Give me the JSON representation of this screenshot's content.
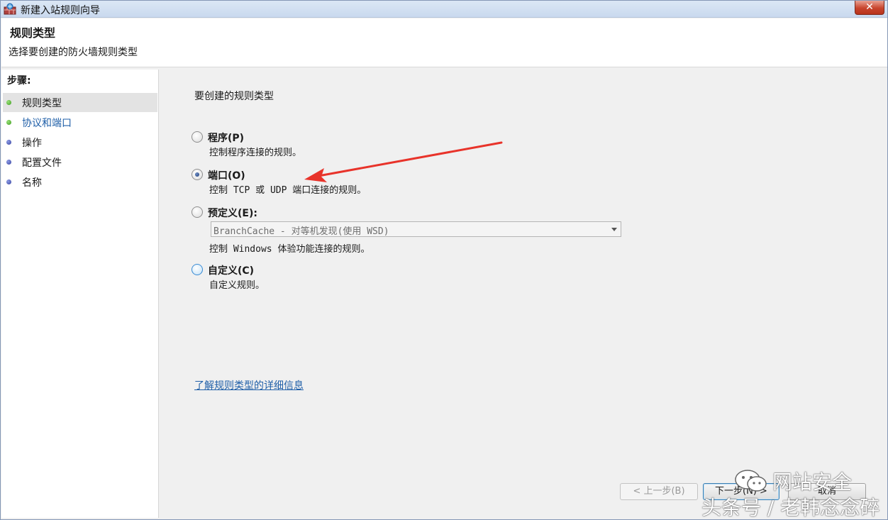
{
  "window": {
    "title": "新建入站规则向导",
    "close_label": "✕"
  },
  "header": {
    "title": "规则类型",
    "subtitle": "选择要创建的防火墙规则类型"
  },
  "sidebar": {
    "steps_label": "步骤:",
    "items": [
      {
        "label": "规则类型",
        "status": "green"
      },
      {
        "label": "协议和端口",
        "status": "green"
      },
      {
        "label": "操作",
        "status": "blue"
      },
      {
        "label": "配置文件",
        "status": "blue"
      },
      {
        "label": "名称",
        "status": "blue"
      }
    ]
  },
  "main": {
    "question": "要创建的规则类型",
    "options": [
      {
        "label": "程序(P)",
        "desc": "控制程序连接的规则。",
        "checked": false
      },
      {
        "label": "端口(O)",
        "desc": "控制 TCP 或 UDP 端口连接的规则。",
        "checked": true
      },
      {
        "label": "预定义(E):",
        "desc": "控制 Windows 体验功能连接的规则。",
        "checked": false
      },
      {
        "label": "自定义(C)",
        "desc": "自定义规则。",
        "checked": false
      }
    ],
    "predefined_select": {
      "value": "BranchCache - 对等机发现(使用 WSD)"
    },
    "more_info_link": "了解规则类型的详细信息"
  },
  "buttons": {
    "back": "< 上一步(B)",
    "next": "下一步(N) >",
    "cancel": "取消"
  },
  "watermark": {
    "line1": "网站安全",
    "line2": "头条号 / 老韩念念碎"
  },
  "colors": {
    "accent_link": "#1f5fa8",
    "step_done": "#3b9a1c",
    "step_pending": "#34409e",
    "annotation_arrow": "#e8332a"
  }
}
